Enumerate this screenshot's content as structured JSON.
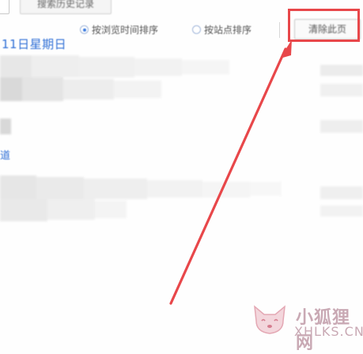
{
  "toolbar": {
    "search_history_label": "搜索历史记录"
  },
  "sort": {
    "options": [
      {
        "label": "按浏览时间排序",
        "checked": true
      },
      {
        "label": "按站点排序",
        "checked": false
      }
    ]
  },
  "clear_button_label": "清除此页",
  "date_header": "11日星期日",
  "history_category_fragment": "道",
  "annotation": {
    "highlight_color": "#e8474a",
    "target": "clear-page-button"
  },
  "watermark": {
    "site_name": "小狐狸网",
    "url": "XHLKS.CN"
  }
}
